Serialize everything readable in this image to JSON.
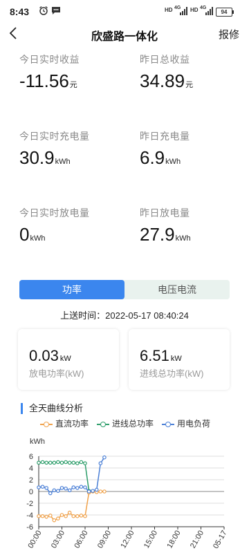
{
  "status_bar": {
    "time": "8:43",
    "battery": "94",
    "net1": "4G",
    "net2": "4G",
    "hd1": "HD",
    "hd2": "HD"
  },
  "nav": {
    "title": "欣盛路一体化",
    "report": "报修"
  },
  "stats": {
    "today_income": {
      "label": "今日实时收益",
      "value": "-11.56",
      "unit": "元"
    },
    "yesterday_income": {
      "label": "昨日总收益",
      "value": "34.89",
      "unit": "元"
    },
    "today_charge": {
      "label": "今日实时充电量",
      "value": "30.9",
      "unit": "kWh"
    },
    "yesterday_charge": {
      "label": "昨日充电量",
      "value": "6.9",
      "unit": "kWh"
    },
    "today_discharge": {
      "label": "今日实时放电量",
      "value": "0",
      "unit": "kWh"
    },
    "yesterday_discharge": {
      "label": "昨日放电量",
      "value": "27.9",
      "unit": "kWh"
    }
  },
  "tabs": {
    "power": "功率",
    "voltage_current": "电压电流"
  },
  "upload_time": "上送时间：2022-05-17 08:40:24",
  "cards": {
    "discharge": {
      "value": "0.03",
      "unit": "kW",
      "label": "放电功率(kW)"
    },
    "incoming": {
      "value": "6.51",
      "unit": "kW",
      "label": "进线总功率(kW)"
    }
  },
  "section_title": "全天曲线分析",
  "chart_data": {
    "type": "line",
    "ylabel": "kWh",
    "ylim": [
      -6,
      6
    ],
    "yticks": [
      "6",
      "4",
      "2",
      "0",
      "-2",
      "-4",
      "-6"
    ],
    "x_labels": [
      "00:00",
      "03:00",
      "06:00",
      "09:00",
      "12:00",
      "15:00",
      "18:00",
      "21:00",
      "05-17"
    ],
    "x_range_hours": [
      0,
      24
    ],
    "series": [
      {
        "name": "直流功率",
        "color": "#f0a24b",
        "x": [
          0,
          0.5,
          1,
          1.5,
          2,
          2.5,
          3,
          3.5,
          4,
          4.5,
          5,
          5.5,
          6,
          6.5,
          7,
          7.5,
          8,
          8.5
        ],
        "y": [
          -4.2,
          -4.2,
          -4.3,
          -4.1,
          -4.9,
          -4.6,
          -4.0,
          -4.2,
          -3.6,
          -4.2,
          -4.2,
          -4.1,
          -4.2,
          -0.2,
          0,
          -0.1,
          0,
          0
        ]
      },
      {
        "name": "进线总功率",
        "color": "#2e9e6b",
        "x": [
          0,
          0.5,
          1,
          1.5,
          2,
          2.5,
          3,
          3.5,
          4,
          4.5,
          5,
          5.5,
          6,
          6.5
        ],
        "y": [
          4.9,
          5.0,
          4.9,
          4.9,
          4.9,
          5.0,
          4.9,
          5.0,
          4.9,
          4.9,
          4.8,
          5.0,
          4.8,
          0.1
        ]
      },
      {
        "name": "用电负荷",
        "color": "#4a7fd6",
        "x": [
          0,
          0.5,
          1,
          1.5,
          2,
          2.5,
          3,
          3.5,
          4,
          4.5,
          5,
          5.5,
          6,
          6.5,
          7,
          7.5,
          8,
          8.5
        ],
        "y": [
          0.7,
          0.8,
          0.6,
          -0.3,
          0.2,
          0.1,
          0.6,
          0.5,
          0.2,
          0.7,
          0.6,
          0.8,
          0.7,
          0.0,
          0.1,
          0.3,
          4.8,
          5.8
        ]
      }
    ]
  }
}
